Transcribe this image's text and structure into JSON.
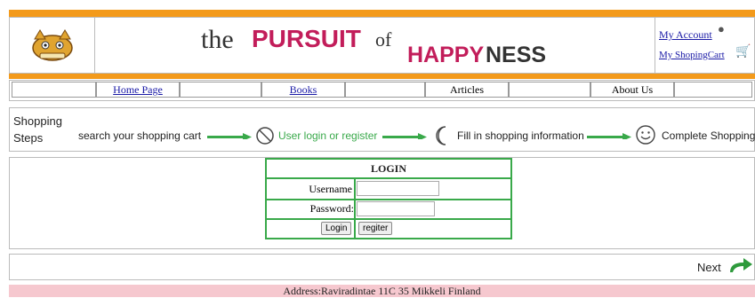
{
  "header": {
    "title_the": "the",
    "title_pursuit": "PURSUIT",
    "title_of": "of",
    "title_happy": "HAPPY",
    "title_ness": "NESS",
    "my_account": "My Account",
    "my_cart": "My ShopingCart"
  },
  "nav": {
    "home": "Home Page",
    "books": "Books",
    "articles": "Articles",
    "about": "About Us"
  },
  "steps": {
    "heading_line1": "Shopping",
    "heading_line2": "Steps",
    "step1": "search your shopping cart",
    "step2": "User login or register",
    "step3": "Fill in shopping information",
    "step4": "Complete Shopping"
  },
  "login": {
    "title": "LOGIN",
    "username_label": "Username",
    "password_label": "Password:",
    "login_button": "Login",
    "register_button": "regiter"
  },
  "footer": {
    "next": "Next",
    "address": "Address:Raviradintae 11C 35 Mikkeli Finland"
  },
  "colors": {
    "orange": "#f39a1b",
    "pink_title": "#c21d5a",
    "green": "#39a94a",
    "footer_pink": "#f6c8cf"
  }
}
